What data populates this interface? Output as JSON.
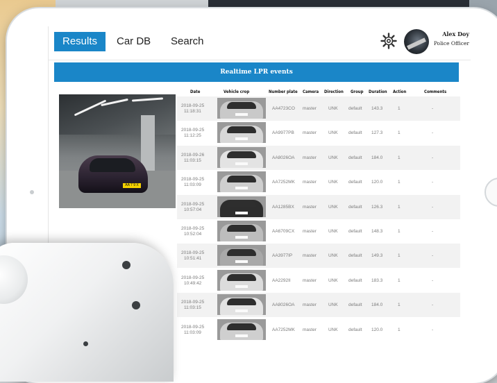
{
  "nav": {
    "tabs": [
      {
        "label": "Results",
        "active": true
      },
      {
        "label": "Car DB",
        "active": false
      },
      {
        "label": "Search",
        "active": false
      }
    ],
    "settings_icon": "gear-icon",
    "user": {
      "name": "Alex Doy",
      "role": "Police Officer"
    }
  },
  "banner": {
    "title": "Realtime LPR events"
  },
  "table": {
    "headers": [
      "Date",
      "Vehicle crop",
      "Number plate",
      "Camera",
      "Direction",
      "Group",
      "Duration",
      "Action",
      "Comments"
    ],
    "rows": [
      {
        "date": "2018-09-25",
        "time": "11:18:31",
        "plate": "AA4723CO",
        "camera": "master",
        "direction": "UNK",
        "group": "default",
        "duration": "143.3",
        "action": "1",
        "comments": "-"
      },
      {
        "date": "2018-09-25",
        "time": "11:12:25",
        "plate": "AA9977PB",
        "camera": "master",
        "direction": "UNK",
        "group": "default",
        "duration": "127.3",
        "action": "1",
        "comments": "-"
      },
      {
        "date": "2018-09-26",
        "time": "11:03:15",
        "plate": "AA8026OA",
        "camera": "master",
        "direction": "UNK",
        "group": "default",
        "duration": "184.0",
        "action": "1",
        "comments": "-"
      },
      {
        "date": "2018-09-25",
        "time": "11:03:09",
        "plate": "AA7252MK",
        "camera": "master",
        "direction": "UNK",
        "group": "default",
        "duration": "120.0",
        "action": "1",
        "comments": "-"
      },
      {
        "date": "2018-09-25",
        "time": "10:57:04",
        "plate": "AA1285BX",
        "camera": "master",
        "direction": "UNK",
        "group": "default",
        "duration": "126.3",
        "action": "1",
        "comments": "-"
      },
      {
        "date": "2018-09-25",
        "time": "10:52:04",
        "plate": "AA6709CX",
        "camera": "master",
        "direction": "UNK",
        "group": "default",
        "duration": "148.3",
        "action": "1",
        "comments": "-"
      },
      {
        "date": "2018-09-25",
        "time": "10:51:41",
        "plate": "AA3977IP",
        "camera": "master",
        "direction": "UNK",
        "group": "default",
        "duration": "149.3",
        "action": "1",
        "comments": "-"
      },
      {
        "date": "2018-09-25",
        "time": "10:49:42",
        "plate": "AA2292II",
        "camera": "master",
        "direction": "UNK",
        "group": "default",
        "duration": "183.3",
        "action": "1",
        "comments": "-"
      },
      {
        "date": "2018-09-25",
        "time": "11:03:15",
        "plate": "AA8026OA",
        "camera": "master",
        "direction": "UNK",
        "group": "default",
        "duration": "184.0",
        "action": "1",
        "comments": "-"
      },
      {
        "date": "2018-09-25",
        "time": "11:03:09",
        "plate": "AA7252MK",
        "camera": "master",
        "direction": "UNK",
        "group": "default",
        "duration": "120.0",
        "action": "1",
        "comments": "-"
      }
    ]
  },
  "snapshot": {
    "plate_text": "AA 7 9 X"
  },
  "colors": {
    "accent": "#1a86c8",
    "row_shade": "#f2f2f2",
    "cell_text": "#7b7b7b"
  }
}
